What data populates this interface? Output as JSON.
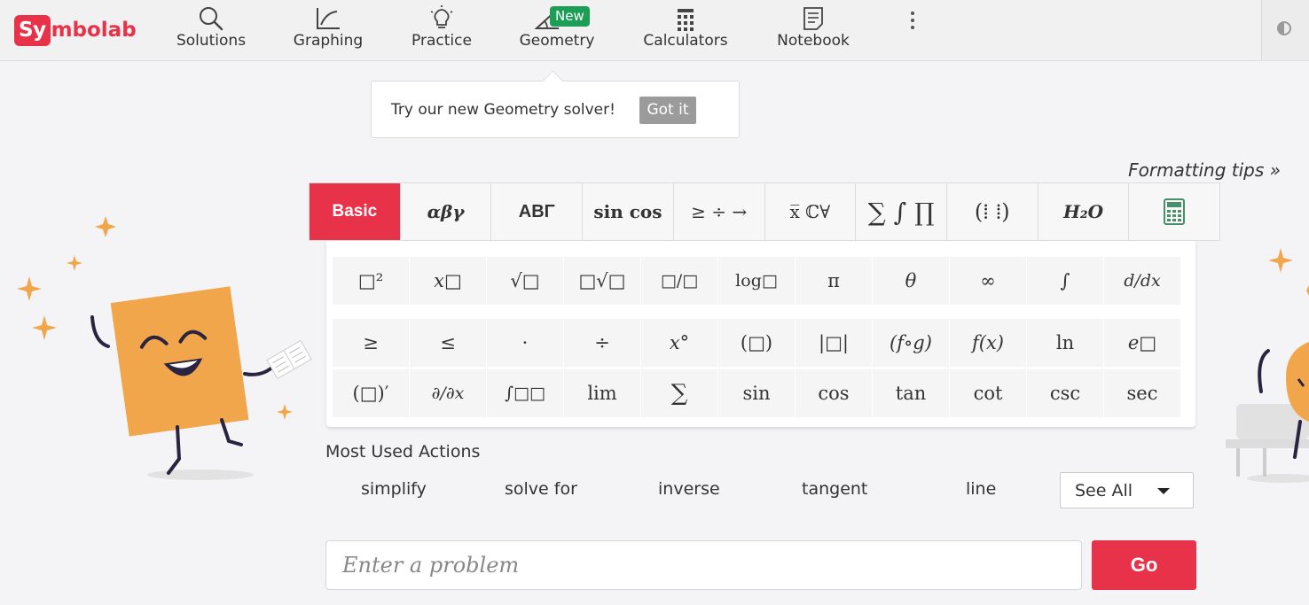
{
  "brand": {
    "logo_highlight": "Sy",
    "logo_rest": "mbolab"
  },
  "nav": {
    "items": [
      {
        "label": "Solutions"
      },
      {
        "label": "Graphing"
      },
      {
        "label": "Practice"
      },
      {
        "label": "Geometry"
      },
      {
        "label": "Calculators"
      },
      {
        "label": "Notebook"
      }
    ],
    "new_badge": "New"
  },
  "tooltip": {
    "text": "Try our new Geometry solver!",
    "button": "Got it"
  },
  "formatting_tips": "Formatting tips »",
  "tabs": [
    {
      "label": "Basic",
      "active": true
    },
    {
      "label": "αβγ"
    },
    {
      "label": "ΑΒΓ"
    },
    {
      "label": "sin cos"
    },
    {
      "label": "≥ ÷ →"
    },
    {
      "label": "x̅ ℂ∀"
    },
    {
      "label": "∑ ∫ ∏"
    },
    {
      "label": "(⁞ ⁞)"
    },
    {
      "label": "H₂O"
    },
    {
      "label": "calculator-icon"
    }
  ],
  "keypad": {
    "row1": [
      "□²",
      "x□",
      "√□",
      "□√□",
      "□/□",
      "log□",
      "π",
      "θ",
      "∞",
      "∫",
      "d/dx"
    ],
    "row2": [
      "≥",
      "≤",
      "·",
      "÷",
      "x°",
      "(□)",
      "|□|",
      "(f∘g)",
      "f(x)",
      "ln",
      "e□"
    ],
    "row3": [
      "(□)′",
      "∂/∂x",
      "∫□□",
      "lim",
      "∑",
      "sin",
      "cos",
      "tan",
      "cot",
      "csc",
      "sec"
    ]
  },
  "most_used": {
    "title": "Most Used Actions",
    "actions": [
      "simplify",
      "solve for",
      "inverse",
      "tangent",
      "line"
    ],
    "see_all": "See All"
  },
  "input": {
    "placeholder": "Enter a problem",
    "go": "Go"
  },
  "colors": {
    "brand": "#e8324a",
    "badge": "#1d9e57",
    "mascot": "#f2a64c"
  }
}
